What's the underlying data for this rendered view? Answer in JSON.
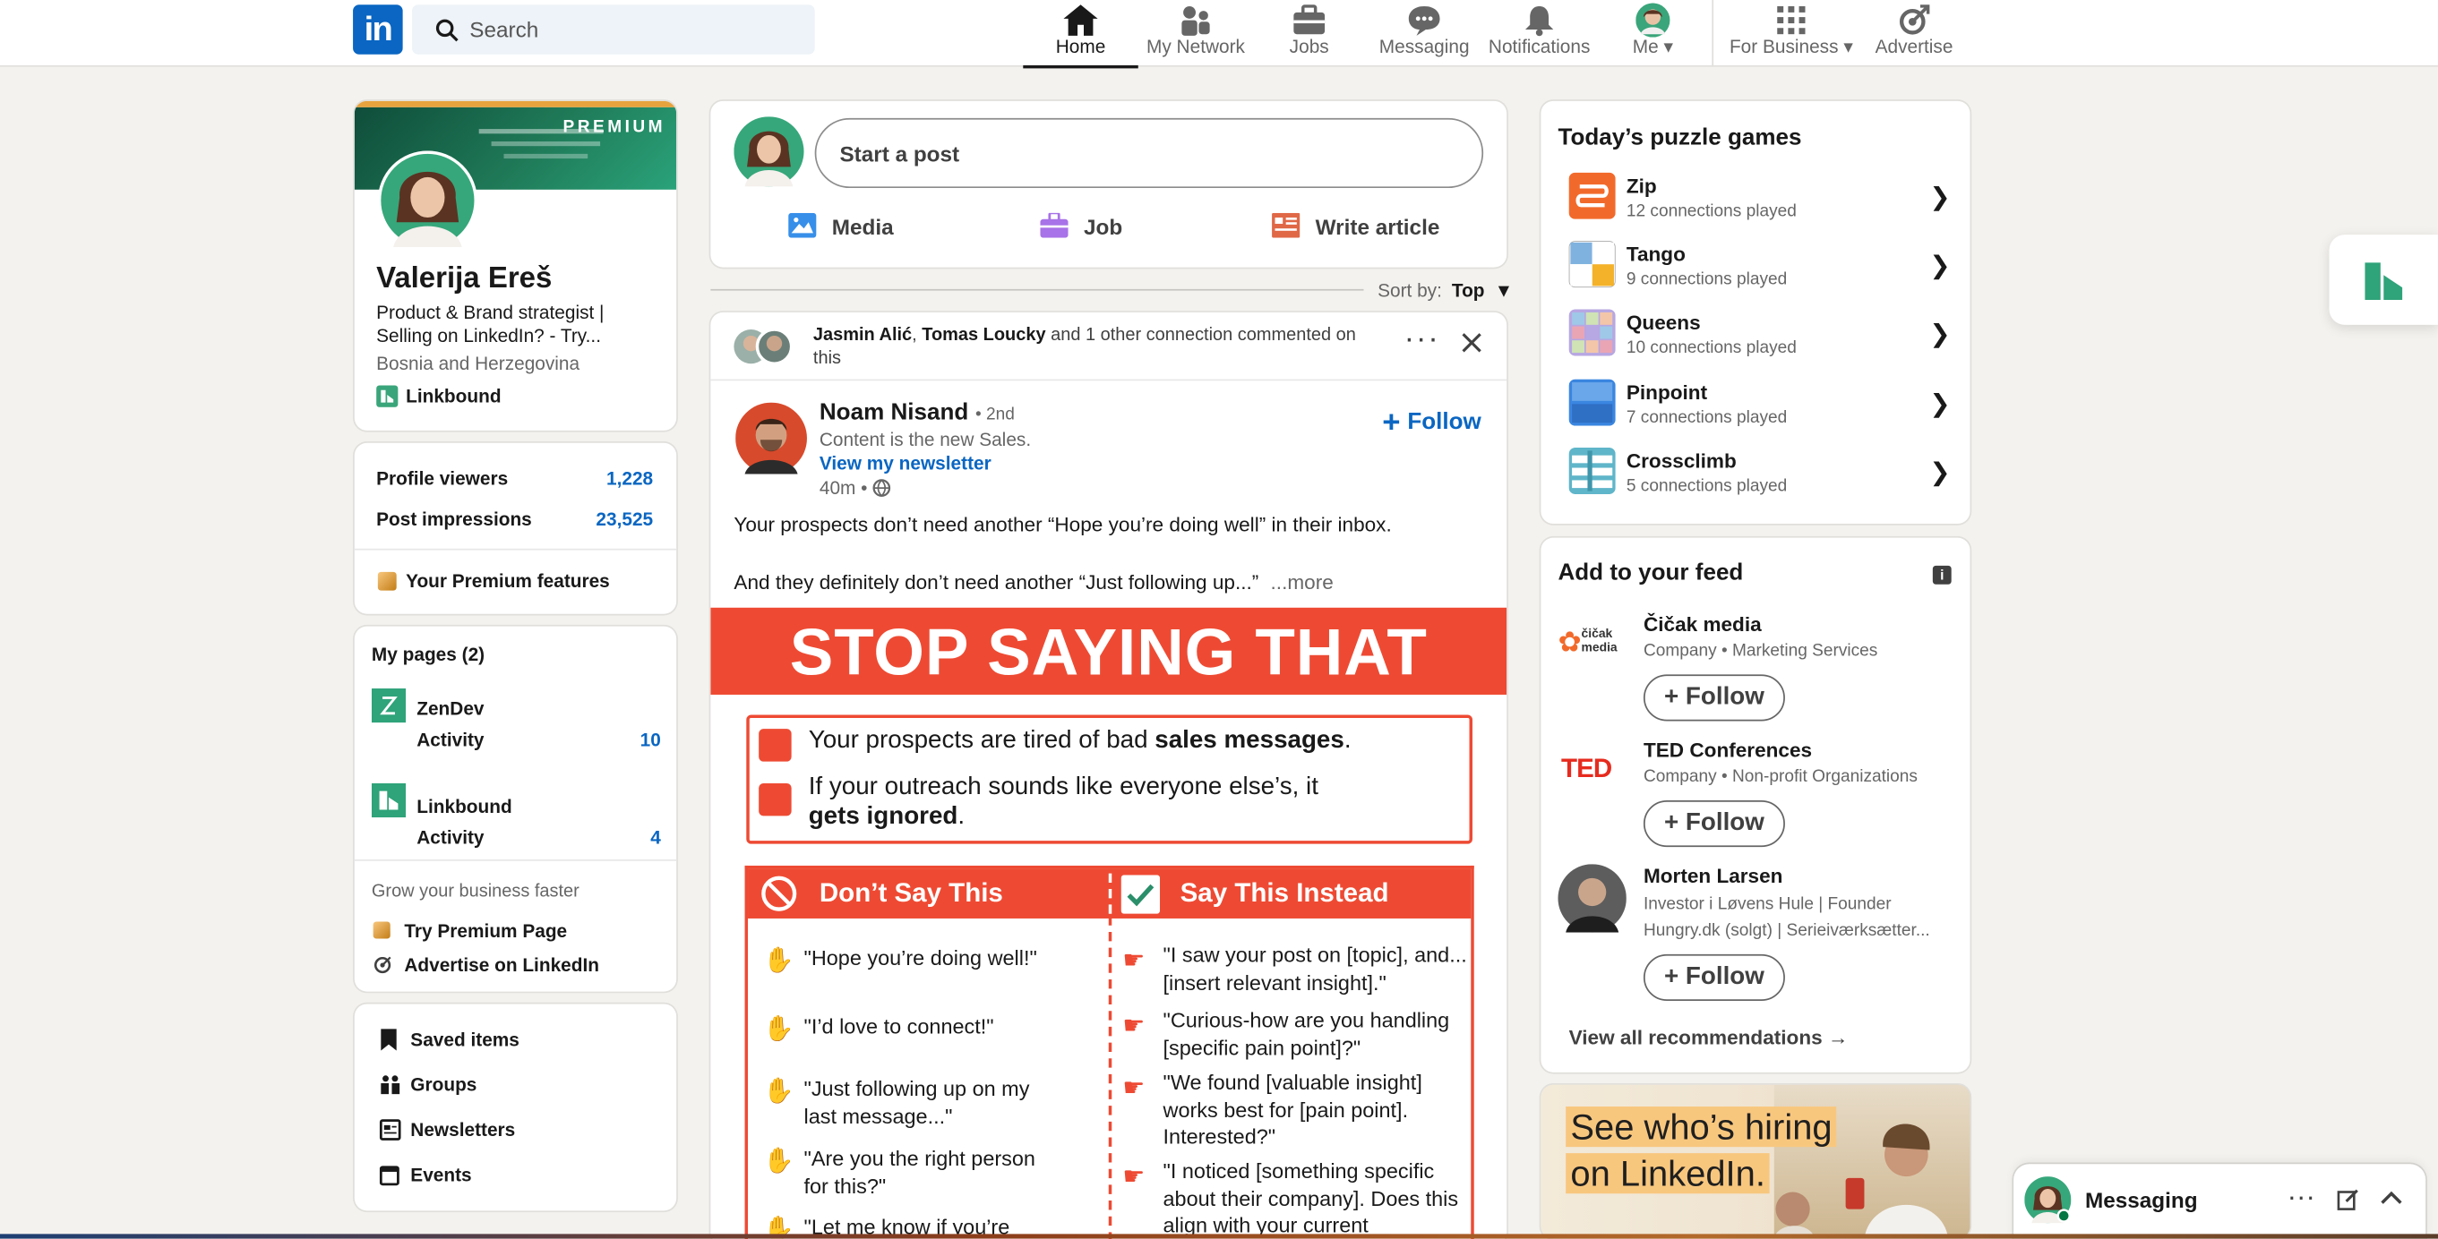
{
  "nav": {
    "search_placeholder": "Search",
    "items": [
      {
        "label": "Home",
        "icon": "home-icon"
      },
      {
        "label": "My Network",
        "icon": "network-icon"
      },
      {
        "label": "Jobs",
        "icon": "jobs-icon"
      },
      {
        "label": "Messaging",
        "icon": "messaging-icon"
      },
      {
        "label": "Notifications",
        "icon": "bell-icon"
      },
      {
        "label": "Me",
        "icon": "avatar"
      },
      {
        "label": "For Business",
        "icon": "grid-icon"
      },
      {
        "label": "Advertise",
        "icon": "advertise-icon"
      }
    ]
  },
  "profile": {
    "banner_label": "PREMIUM",
    "name": "Valerija Ereš",
    "headline": "Product & Brand strategist | Selling on LinkedIn? - Try...",
    "location": "Bosnia and Herzegovina",
    "company": "Linkbound",
    "stats": [
      {
        "label": "Profile viewers",
        "value": "1,228"
      },
      {
        "label": "Post impressions",
        "value": "23,525"
      }
    ],
    "premium_features": "Your Premium features"
  },
  "pages": {
    "title": "My pages (2)",
    "items": [
      {
        "name": "ZenDev",
        "activity_label": "Activity",
        "activity": "10"
      },
      {
        "name": "Linkbound",
        "activity_label": "Activity",
        "activity": "4"
      }
    ],
    "grow_label": "Grow your business faster",
    "try_premium": "Try Premium Page",
    "advertise": "Advertise on LinkedIn"
  },
  "shortcuts": [
    "Saved items",
    "Groups",
    "Newsletters",
    "Events"
  ],
  "composer": {
    "placeholder": "Start a post",
    "media": "Media",
    "job": "Job",
    "article": "Write article"
  },
  "sort": {
    "label": "Sort by:",
    "value": "Top"
  },
  "post": {
    "social_names_1": "Jasmin Alić",
    "social_names_2": "Tomas Loucky",
    "social_rest": "and 1 other connection commented on",
    "social_tail": "this",
    "author": "Noam Nisand",
    "degree": "• 2nd",
    "author_headline": "Content is the new Sales.",
    "newsletter": "View my newsletter",
    "time": "40m •",
    "follow": "Follow",
    "text_line1": "Your prospects don’t need another “Hope you’re doing well” in their inbox.",
    "text_line2": "And they definitely don’t need another “Just following up...”",
    "more": "...more"
  },
  "infographic": {
    "headline": "STOP SAYING THAT",
    "box_line1a": "Your prospects are tired of bad ",
    "box_line1b": "sales messages",
    "box_line1c": ".",
    "box_line2a": "If your outreach sounds like everyone else’s, it",
    "box_line2b": "gets ignored",
    "box_line2c": ".",
    "col_left": "Don’t Say This",
    "col_right": "Say This Instead",
    "left_items": [
      "\"Hope you’re doing well!\"",
      "\"I’d love to connect!\"",
      "\"Just following up on my last message...\"",
      "\"Are you the right person for this?\"",
      "\"Let me know if you’re"
    ],
    "right_items": [
      "\"I saw your post on [topic], and... [insert relevant insight].\"",
      "\"Curious-how are you handling [specific pain point]?\"",
      "\"We found [valuable insight] works best for [pain point]. Interested?\"",
      "\"I noticed [something specific about their company]. Does this align with your current"
    ]
  },
  "puzzles": {
    "title": "Today’s puzzle games",
    "items": [
      {
        "name": "Zip",
        "sub": "12 connections played"
      },
      {
        "name": "Tango",
        "sub": "9 connections played"
      },
      {
        "name": "Queens",
        "sub": "10 connections played"
      },
      {
        "name": "Pinpoint",
        "sub": "7 connections played"
      },
      {
        "name": "Crossclimb",
        "sub": "5 connections played"
      }
    ]
  },
  "feed": {
    "title": "Add to your feed",
    "items": [
      {
        "name": "Čičak media",
        "sub": "Company • Marketing Services",
        "logo_text": "čičak media"
      },
      {
        "name": "TED Conferences",
        "sub": "Company • Non-profit Organizations",
        "logo_text": "TED"
      },
      {
        "name": "Morten Larsen",
        "sub": "Investor i Løvens Hule | Founder Hungry.dk (solgt) | Serieiværksætter..."
      }
    ],
    "follow": "Follow",
    "view_all": "View all recommendations →"
  },
  "ad": {
    "line1": "See who’s hiring",
    "line2": "on LinkedIn."
  },
  "messaging": {
    "label": "Messaging"
  },
  "colors": {
    "brand": "#0a66c2",
    "accent_red": "#ee4a33",
    "premium_gold": "#e7a33e"
  }
}
